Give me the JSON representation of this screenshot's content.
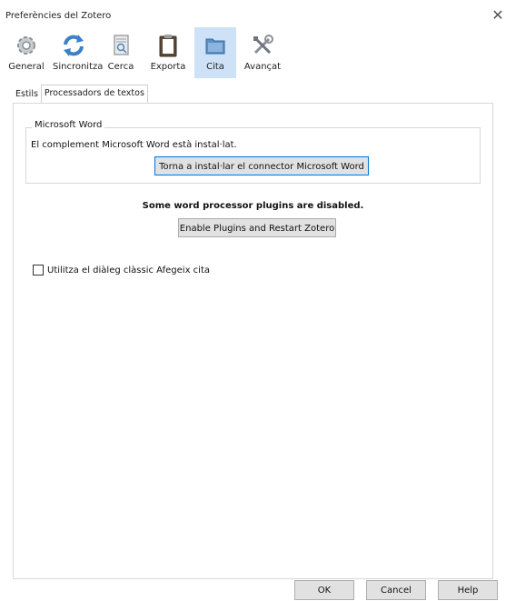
{
  "window": {
    "title": "Preferències del Zotero"
  },
  "toolbar": {
    "items": [
      {
        "label": "General",
        "icon": "gear-icon"
      },
      {
        "label": "Sincronitza",
        "icon": "sync-icon"
      },
      {
        "label": "Cerca",
        "icon": "search-doc-icon"
      },
      {
        "label": "Exporta",
        "icon": "clipboard-icon"
      },
      {
        "label": "Cita",
        "icon": "folder-icon",
        "selected": true
      },
      {
        "label": "Avançat",
        "icon": "tools-icon"
      }
    ]
  },
  "tabs": [
    {
      "label": "Estils",
      "active": false
    },
    {
      "label": "Processadors de textos",
      "active": true
    }
  ],
  "word": {
    "group_title": "Microsoft Word",
    "installed_text": "El complement Microsoft Word està instal·lat.",
    "reinstall_label": "Torna a instal·lar el connector Microsoft Word"
  },
  "plugins": {
    "warning": "Some word processor plugins are disabled.",
    "enable_label": "Enable Plugins and Restart Zotero"
  },
  "options": {
    "classic_dialog_label": "Utilitza el diàleg clàssic Afegeix cita",
    "classic_dialog_checked": false
  },
  "footer": {
    "ok": "OK",
    "cancel": "Cancel",
    "help": "Help"
  },
  "colors": {
    "selected_tab_bg": "#cde2f7",
    "focus_border": "#0078d7"
  }
}
